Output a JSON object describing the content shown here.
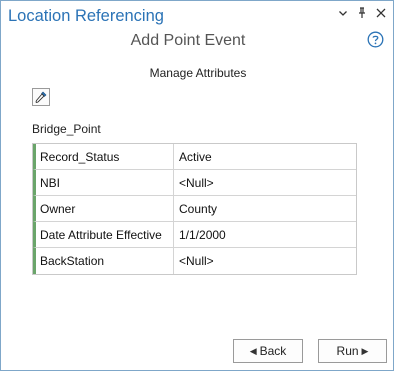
{
  "pane": {
    "title": "Location Referencing",
    "controls": [
      "chevron-down-icon",
      "pin-icon",
      "close-icon"
    ]
  },
  "tool": {
    "title": "Add Point Event",
    "help_icon": "help-circle-icon"
  },
  "section": {
    "subtitle": "Manage Attributes",
    "picker_icon": "eyedropper-icon"
  },
  "layer": {
    "name": "Bridge_Point"
  },
  "attributes": [
    {
      "field": "Record_Status",
      "value": "Active"
    },
    {
      "field": "NBI",
      "value": "<Null>"
    },
    {
      "field": "Owner",
      "value": "County"
    },
    {
      "field": "Date Attribute Effective",
      "value": "1/1/2000"
    },
    {
      "field": "BackStation",
      "value": "<Null>"
    }
  ],
  "buttons": {
    "back_label": "Back",
    "back_glyph": "◀",
    "run_label": "Run",
    "run_glyph": "▶"
  },
  "colors": {
    "accent": "#2b73b6",
    "row_marker": "#6aa56a",
    "border": "#7fa7c9"
  }
}
